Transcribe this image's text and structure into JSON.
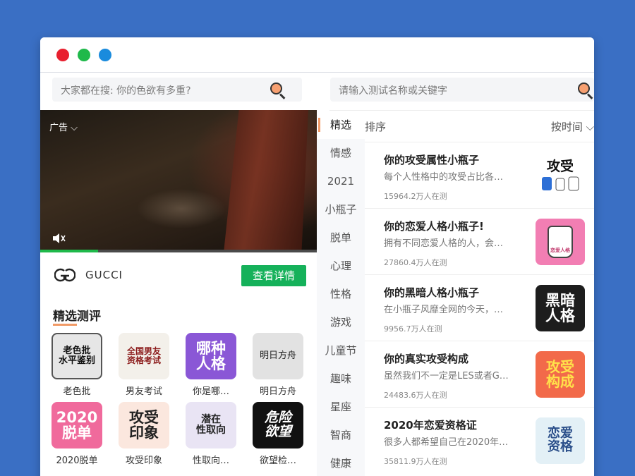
{
  "window": {
    "dots": [
      "#e8202f",
      "#1fb94a",
      "#1a8bdd"
    ]
  },
  "left": {
    "search_placeholder": "大家都在搜: 你的色欲有多重?",
    "ad_label": "广告",
    "video_progress": 0.21,
    "brand_name": "GUCCI",
    "detail_button": "查看详情",
    "section_title": "精选测评",
    "tiles": [
      {
        "label": "老色批",
        "art": "老色批\n水平鉴别"
      },
      {
        "label": "男友考试",
        "art": "全国男友\n资格考试"
      },
      {
        "label": "你是哪…",
        "art": "哪种\n人格"
      },
      {
        "label": "明日方舟",
        "art": "明日方舟"
      },
      {
        "label": "2020脱单",
        "art": "2020\n脱单"
      },
      {
        "label": "攻受印象",
        "art": "攻受\n印象"
      },
      {
        "label": "性取向…",
        "art": "潜在\n性取向"
      },
      {
        "label": "欲望检…",
        "art": "危险\n欲望"
      }
    ]
  },
  "categories": [
    "精选",
    "情感",
    "2021",
    "小瓶子",
    "脱单",
    "心理",
    "性格",
    "游戏",
    "儿童节",
    "趣味",
    "星座",
    "智商",
    "健康"
  ],
  "right": {
    "search_placeholder": "请输入测试名称或关键字",
    "sort_label": "排序",
    "sort_time": "按时间",
    "items": [
      {
        "title": "你的攻受属性小瓶子",
        "desc": "每个人性格中的攻受占比各…",
        "count": "15964.2万人在测",
        "art": "攻受"
      },
      {
        "title": "你的恋爱人格小瓶子!",
        "desc": "拥有不同恋爱人格的人，会…",
        "count": "27860.4万人在测",
        "art": "恋爱人格"
      },
      {
        "title": "你的黑暗人格小瓶子",
        "desc": "在小瓶子风靡全网的今天，…",
        "count": "9956.7万人在测",
        "art": "黑暗\n人格"
      },
      {
        "title": "你的真实攻受构成",
        "desc": "虽然我们不一定是LES或者G…",
        "count": "24483.6万人在测",
        "art": "攻受\n构成"
      },
      {
        "title": "2020年恋爱资格证",
        "desc": "很多人都希望自己在2020年…",
        "count": "35811.9万人在测",
        "art": "恋爱\n资格"
      }
    ]
  }
}
